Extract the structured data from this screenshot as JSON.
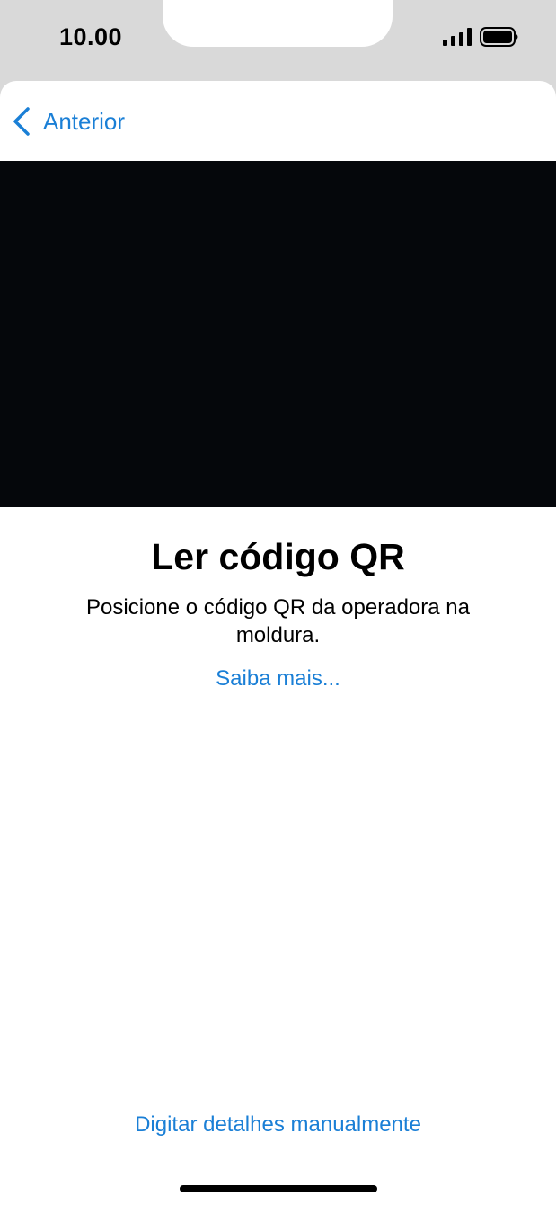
{
  "status_bar": {
    "time": "10.00",
    "signal_icon": "cellular-signal-icon",
    "battery_icon": "battery-icon"
  },
  "nav": {
    "back_label": "Anterior",
    "back_icon": "chevron-left-icon"
  },
  "main": {
    "title": "Ler código QR",
    "instructions": "Posicione o código QR da operadora na moldura.",
    "learn_more": "Saiba mais...",
    "manual_entry": "Digitar detalhes manualmente"
  },
  "colors": {
    "accent": "#1a7fd6",
    "camera_background": "#05070b",
    "status_bar_background": "#d9d9d9"
  }
}
